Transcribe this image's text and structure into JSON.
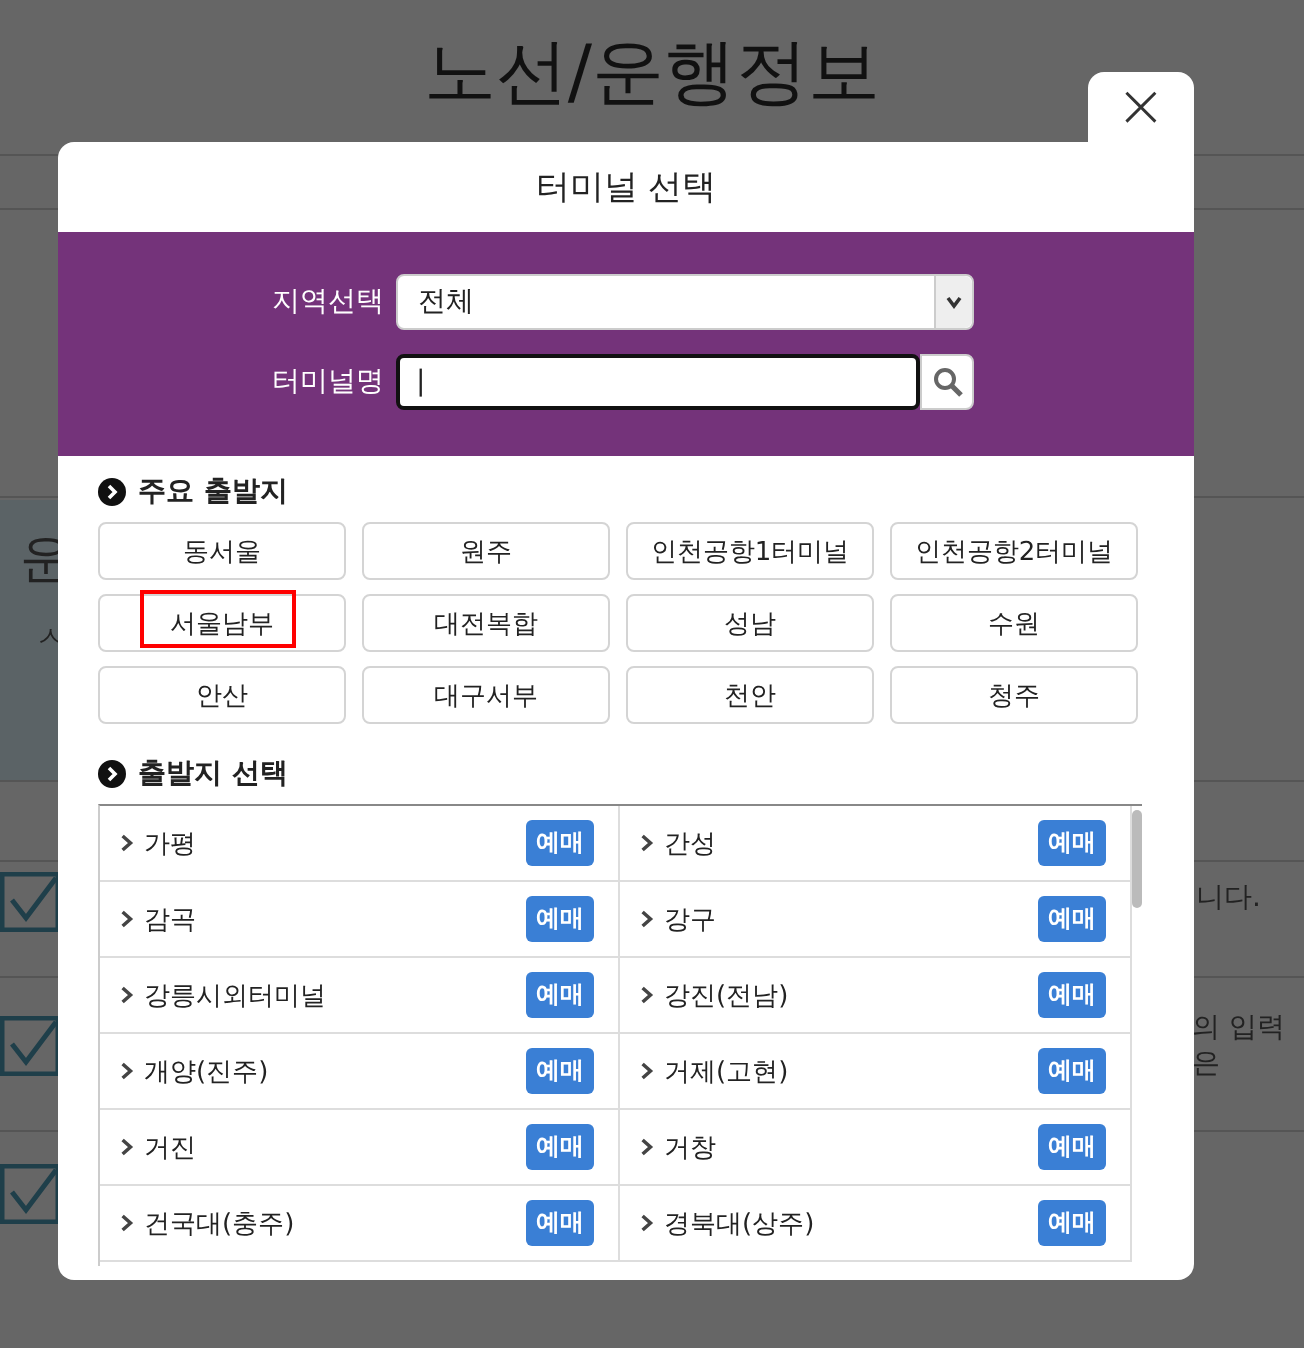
{
  "page": {
    "title": "노선/운행정보",
    "fragments": [
      "운",
      "ㅅ",
      "니다.",
      "의 입력은"
    ]
  },
  "dialog": {
    "title": "터미널 선택",
    "close": "×",
    "region": {
      "label": "지역선택",
      "value": "전체"
    },
    "terminal_name": {
      "label": "터미널명",
      "value": "|"
    },
    "major": {
      "heading": "주요 출발지",
      "buttons": [
        {
          "label": "동서울",
          "highlighted": false
        },
        {
          "label": "원주",
          "highlighted": false
        },
        {
          "label": "인천공항1터미널",
          "highlighted": false
        },
        {
          "label": "인천공항2터미널",
          "highlighted": false
        },
        {
          "label": "서울남부",
          "highlighted": true
        },
        {
          "label": "대전복합",
          "highlighted": false
        },
        {
          "label": "성남",
          "highlighted": false
        },
        {
          "label": "수원",
          "highlighted": false
        },
        {
          "label": "안산",
          "highlighted": false
        },
        {
          "label": "대구서부",
          "highlighted": false
        },
        {
          "label": "천안",
          "highlighted": false
        },
        {
          "label": "청주",
          "highlighted": false
        }
      ]
    },
    "departures": {
      "heading": "출발지 선택",
      "items": [
        {
          "name": "가평",
          "badge": "예매"
        },
        {
          "name": "간성",
          "badge": "예매"
        },
        {
          "name": "감곡",
          "badge": "예매"
        },
        {
          "name": "강구",
          "badge": "예매"
        },
        {
          "name": "강릉시외터미널",
          "badge": "예매"
        },
        {
          "name": "강진(전남)",
          "badge": "예매"
        },
        {
          "name": "개양(진주)",
          "badge": "예매"
        },
        {
          "name": "거제(고현)",
          "badge": "예매"
        },
        {
          "name": "거진",
          "badge": "예매"
        },
        {
          "name": "거창",
          "badge": "예매"
        },
        {
          "name": "건국대(충주)",
          "badge": "예매"
        },
        {
          "name": "경북대(상주)",
          "badge": "예매"
        }
      ]
    }
  }
}
